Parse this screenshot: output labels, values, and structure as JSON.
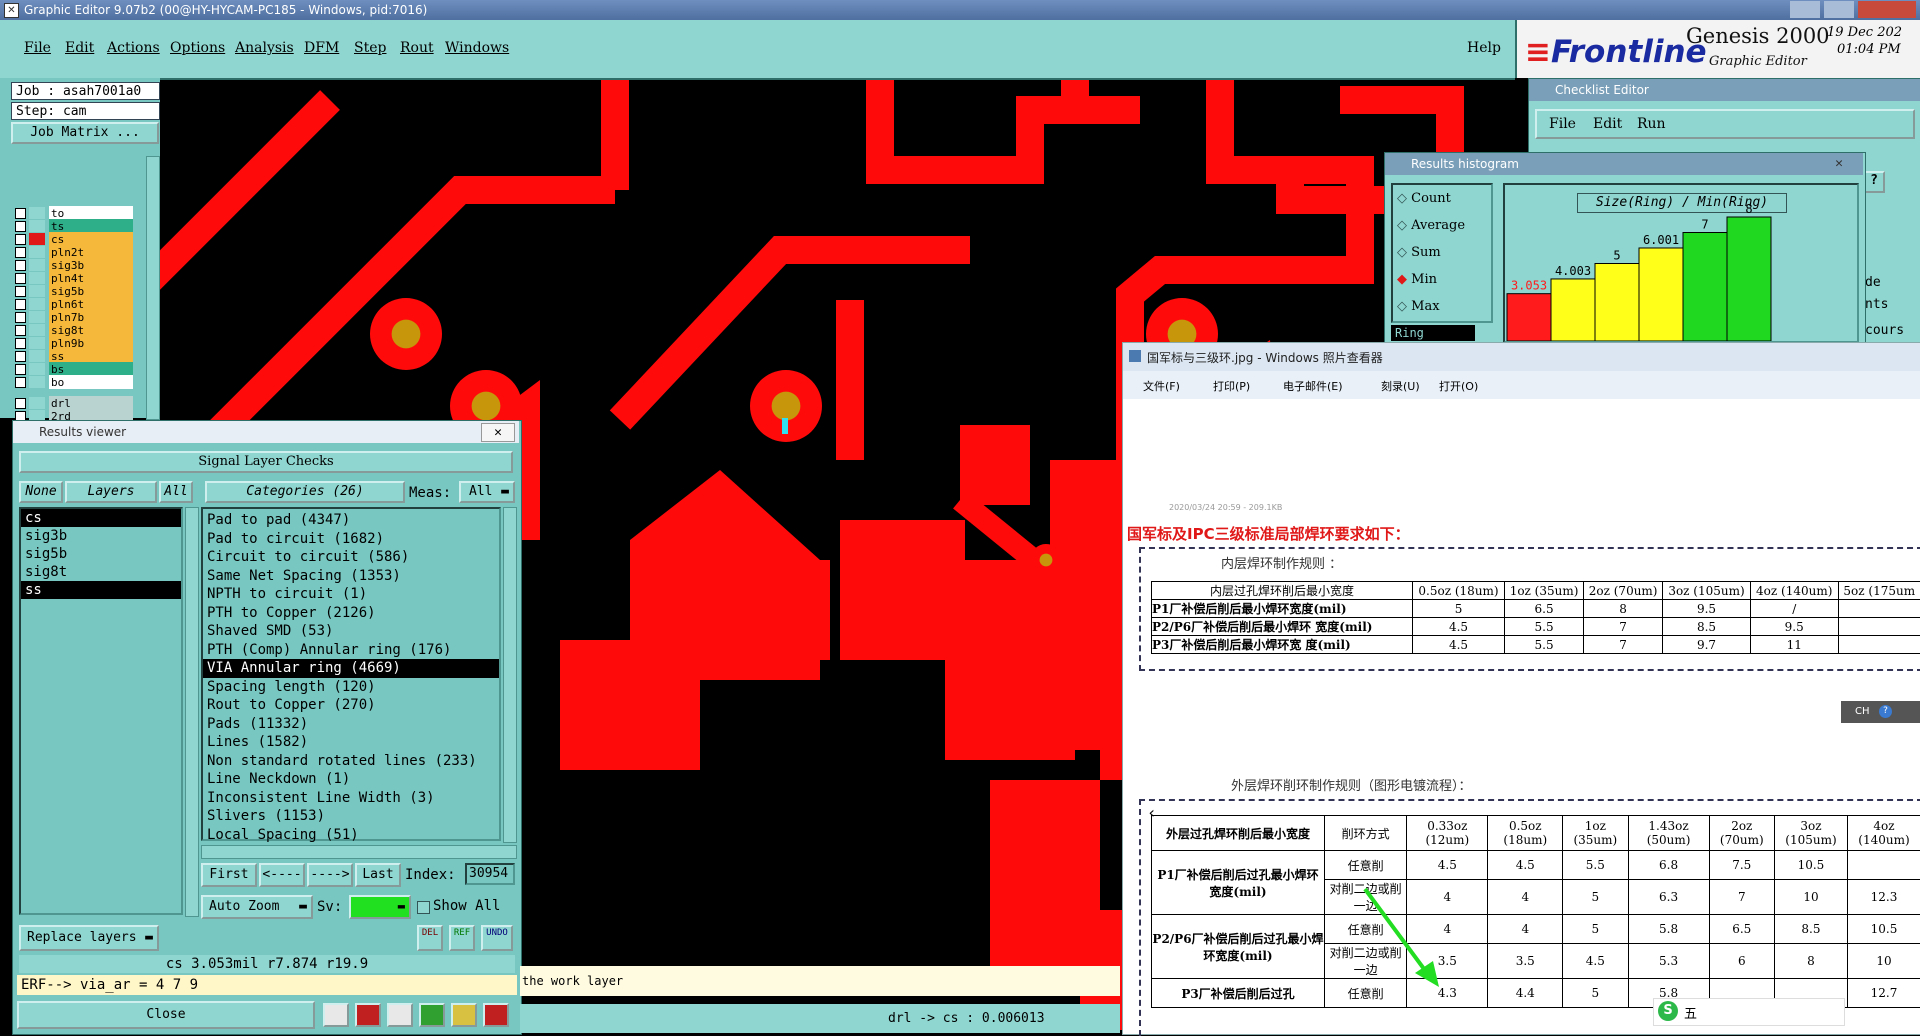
{
  "app": {
    "title": "Graphic Editor 9.07b2 (00@HY-HYCAM-PC185 - Windows, pid:7016)",
    "menu": [
      "File",
      "Edit",
      "Actions",
      "Options",
      "Analysis",
      "DFM",
      "Step",
      "Rout",
      "Windows"
    ],
    "help": "Help",
    "brand": "Frontline",
    "product": "Genesis 2000",
    "product_sub": "Graphic Editor",
    "date": "19 Dec 202",
    "time": "01:04 PM"
  },
  "job": {
    "job_label": "Job : asah7001a0",
    "step_label": "Step: cam",
    "matrix_button": "Job Matrix ..."
  },
  "layers": [
    {
      "name": "to",
      "color": "#ffffff"
    },
    {
      "name": "ts",
      "color": "#2fae8a"
    },
    {
      "name": "cs",
      "color": "#f5b83a"
    },
    {
      "name": "pln2t",
      "color": "#f5b83a"
    },
    {
      "name": "sig3b",
      "color": "#f5b83a"
    },
    {
      "name": "pln4t",
      "color": "#f5b83a"
    },
    {
      "name": "sig5b",
      "color": "#f5b83a"
    },
    {
      "name": "pln6t",
      "color": "#f5b83a"
    },
    {
      "name": "pln7b",
      "color": "#f5b83a"
    },
    {
      "name": "sig8t",
      "color": "#f5b83a"
    },
    {
      "name": "pln9b",
      "color": "#f5b83a"
    },
    {
      "name": "ss",
      "color": "#f5b83a"
    },
    {
      "name": "bs",
      "color": "#2fae8a"
    },
    {
      "name": "bo",
      "color": "#ffffff"
    },
    {
      "name": "drl",
      "color": "#b9d3d0"
    },
    {
      "name": "2rd",
      "color": "#b9d3d0"
    }
  ],
  "results_viewer": {
    "title": "Results viewer",
    "header": "Signal Layer Checks",
    "none_btn": "None",
    "layers_btn": "Layers",
    "all_btn": "All",
    "layer_list": [
      "cs",
      "sig3b",
      "sig5b",
      "sig8t",
      "ss"
    ],
    "categories_btn": "Categories (26)",
    "meas_label": "Meas:",
    "meas_value": "All",
    "categories": [
      "Pad to pad (4347)",
      "Pad to circuit (1682)",
      "Circuit to circuit (586)",
      "Same Net Spacing (1353)",
      "NPTH to circuit (1)",
      "PTH to Copper (2126)",
      "Shaved SMD (53)",
      "PTH (Comp) Annular ring (176)",
      "VIA Annular ring (4669)",
      "Spacing length (120)",
      "Rout to Copper (270)",
      "Pads (11332)",
      "Lines (1582)",
      "Non standard rotated lines (233)",
      "Line Neckdown (1)",
      "Inconsistent Line Width (3)",
      "Slivers (1153)",
      "Local Spacing (51)"
    ],
    "first_btn": "First",
    "prev_btn": "<----",
    "next_btn": "---->",
    "last_btn": "Last",
    "index_label": "Index:",
    "index_value": "30954",
    "auto_zoom": "Auto Zoom",
    "sv_label": "Sv:",
    "show_all": "Show All",
    "replace_layers": "Replace layers",
    "del_icon": "DEL",
    "ref_icon": "REF",
    "undo_icon": "UNDO",
    "measure_text": "cs 3.053mil  r7.874  r19.9",
    "erf_text": "ERF--> via_ar = 4 7 9",
    "close_btn": "Close"
  },
  "status": {
    "work_layer": "the work layer",
    "drl_text": "drl -> cs : 0.006013"
  },
  "checklist": {
    "title": "Checklist Editor",
    "menu": [
      "File",
      "Edit",
      "Run"
    ],
    "side_text": [
      "de",
      "nts",
      "cours"
    ],
    "help_mark": "?"
  },
  "histogram": {
    "title": "Results histogram",
    "options": [
      "Count",
      "Average",
      "Sum",
      "Min",
      "Max"
    ],
    "selected": "Min",
    "field": "Ring",
    "chart_title": "Size(Ring) / Min(Ring)",
    "bars": [
      {
        "label": "3.053",
        "value": 3.053,
        "color": "#ff1b1b",
        "label_color": "#ff1b1b"
      },
      {
        "label": "4.003",
        "value": 4.003,
        "color": "#ffff1a",
        "label_color": "#000000"
      },
      {
        "label": "5",
        "value": 5,
        "color": "#ffff1a",
        "label_color": "#000000"
      },
      {
        "label": "6.001",
        "value": 6.001,
        "color": "#ffff1a",
        "label_color": "#000000"
      },
      {
        "label": "7",
        "value": 7,
        "color": "#20d820",
        "label_color": "#000000"
      },
      {
        "label": "8",
        "value": 8,
        "color": "#20d820",
        "label_color": "#000000"
      }
    ]
  },
  "photo_viewer": {
    "title": "国军标与三级环.jpg - Windows 照片查看器",
    "menu": [
      "文件(F)",
      "打印(P)",
      "电子邮件(E)",
      "刻录(U)",
      "打开(O)"
    ],
    "meta": "2020/03/24 20:59 - 209.1KB",
    "heading": "国军标及IPC三级标准局部焊环要求如下：",
    "inner_title": "内层焊环制作规则 ：",
    "inner_header": [
      "内层过孔焊环削后最小宽度",
      "0.5oz (18um)",
      "1oz (35um)",
      "2oz (70um)",
      "3oz (105um)",
      "4oz (140um)",
      "5oz (175um"
    ],
    "inner_rows": [
      [
        "P1厂补偿后削后最小焊环宽度(mil)",
        "5",
        "6.5",
        "8",
        "9.5",
        "/"
      ],
      [
        "P2/P6厂补偿后削后最小焊环 宽度(mil)",
        "4.5",
        "5.5",
        "7",
        "8.5",
        "9.5"
      ],
      [
        "P3厂补偿后削后最小焊环宽 度(mil)",
        "4.5",
        "5.5",
        "7",
        "9.7",
        "11"
      ]
    ],
    "outer_title": "外层焊环削环制作规则（图形电镀流程）：",
    "outer_header": [
      "外层过孔焊环削后最小宽度",
      "削环方式",
      "0.33oz (12um)",
      "0.5oz (18um)",
      "1oz (35um)",
      "1.43oz (50um)",
      "2oz (70um)",
      "3oz (105um)",
      "4oz (140um)"
    ],
    "outer_groups": [
      {
        "label": "P1厂补偿后削后过孔最小焊环宽度(mil)",
        "rows": [
          [
            "任意削",
            "4.5",
            "4.5",
            "5.5",
            "6.8",
            "7.5",
            "10.5",
            ""
          ],
          [
            "对削二边或削一边",
            "4",
            "4",
            "5",
            "6.3",
            "7",
            "10",
            "12.3"
          ]
        ]
      },
      {
        "label": "P2/P6厂补偿后削后过孔最小焊环宽度(mil)",
        "rows": [
          [
            "任意削",
            "4",
            "4",
            "5",
            "5.8",
            "6.5",
            "8.5",
            "10.5"
          ],
          [
            "对削二边或削一边",
            "3.5",
            "3.5",
            "4.5",
            "5.3",
            "6",
            "8",
            "10"
          ]
        ]
      },
      {
        "label": "P3厂补偿后削后过孔",
        "rows": [
          [
            "任意削",
            "4.3",
            "4.4",
            "5",
            "5.8",
            "",
            "",
            "12.7"
          ]
        ]
      }
    ],
    "ime": "五",
    "ime_tag": "CH"
  },
  "colors": {
    "copper": "#ff0a0a",
    "pad_hole": "#c8960a",
    "ui_cyan": "#8fd6d0",
    "ui_dark": "#79c7c1"
  }
}
